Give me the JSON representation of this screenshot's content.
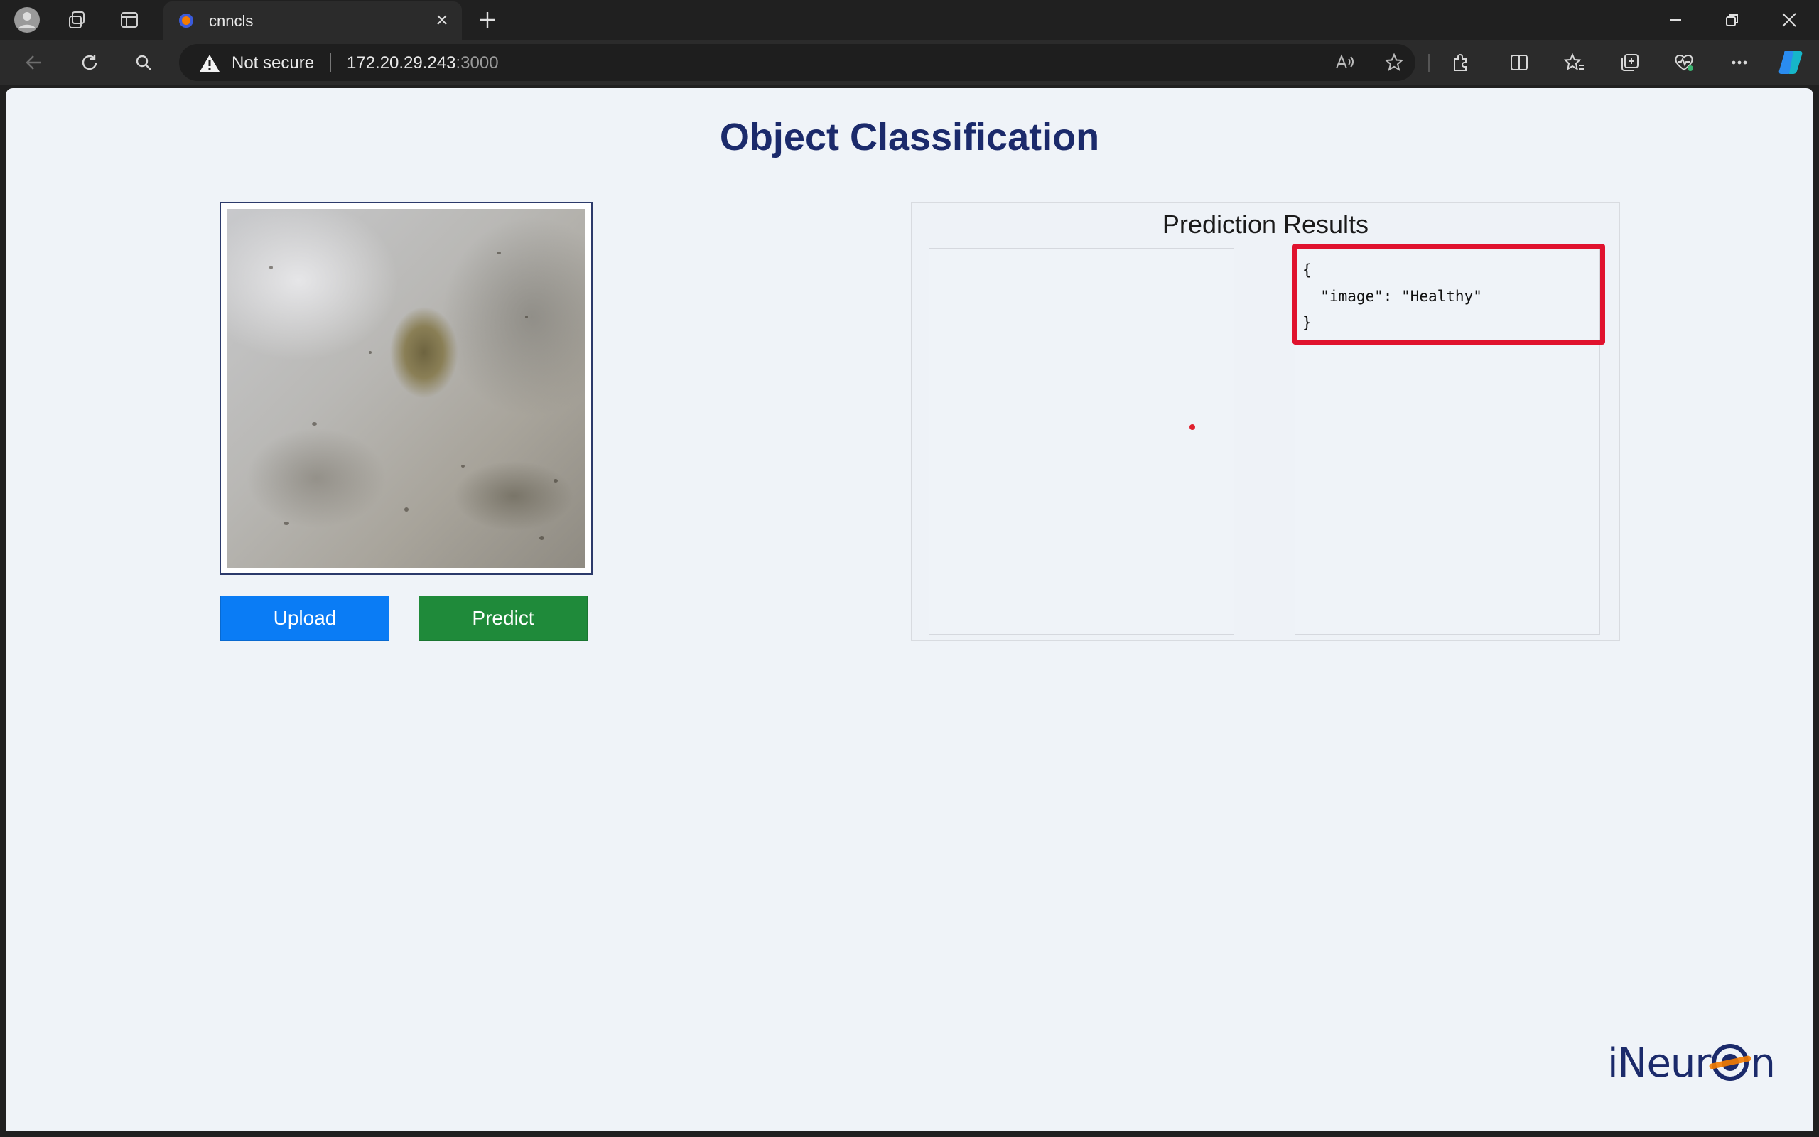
{
  "browser": {
    "tab_title": "cnncls",
    "security_label": "Not secure",
    "url_host": "172.20.29.243",
    "url_port": ":3000",
    "icons": [
      "profile-icon",
      "workspaces-icon",
      "tab-actions-icon",
      "close-icon",
      "new-tab-icon",
      "minimize-icon",
      "restore-icon",
      "back-icon",
      "refresh-icon",
      "search-icon",
      "warning-icon",
      "read-aloud-icon",
      "favorite-star-icon",
      "extensions-icon",
      "split-screen-icon",
      "favorites-icon",
      "collections-icon",
      "browser-essentials-icon",
      "more-icon",
      "copilot-icon"
    ]
  },
  "page": {
    "title": "Object Classification",
    "upload_label": "Upload",
    "predict_label": "Predict",
    "results": {
      "title": "Prediction Results",
      "json_line1": "{",
      "json_line2": "  \"image\": \"Healthy\"",
      "json_line3": "}"
    },
    "logo_prefix": "iNeur",
    "logo_suffix": "n"
  },
  "colors": {
    "title": "#1b2a6b",
    "upload_button": "#0a7cf5",
    "predict_button": "#1f8a3a",
    "highlight": "#e0122e",
    "page_background": "#eff3f8"
  }
}
